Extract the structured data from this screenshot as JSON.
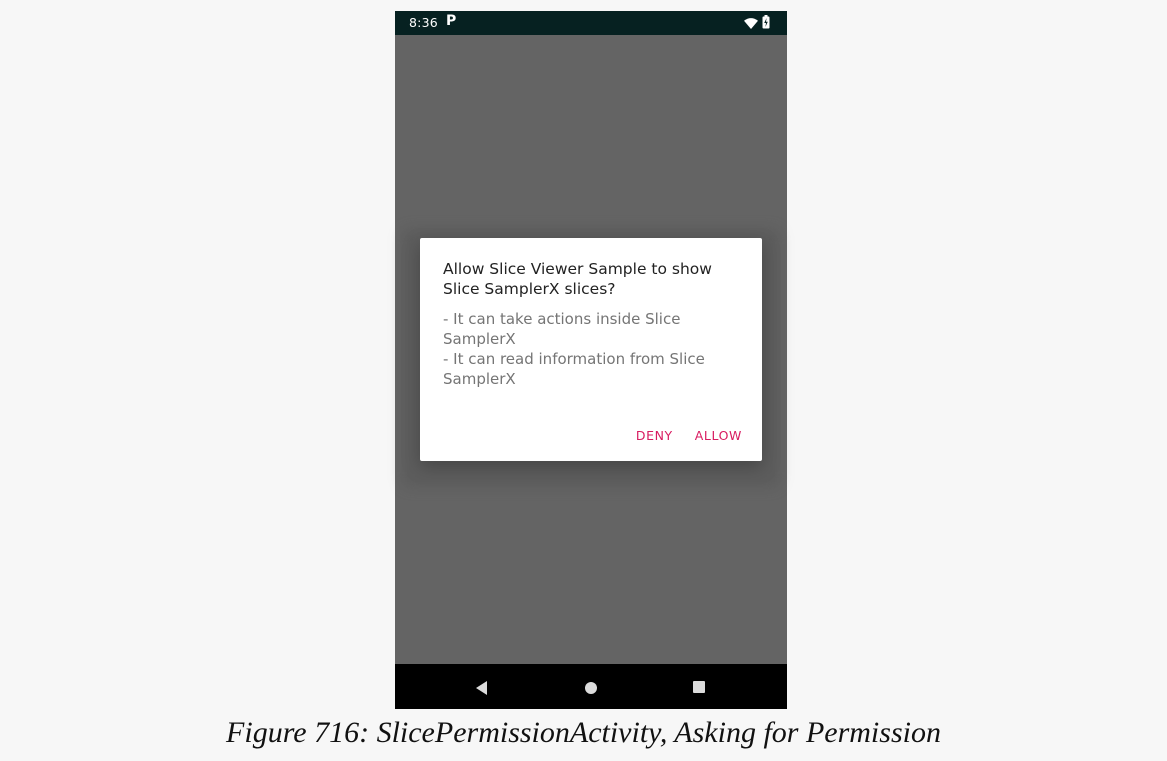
{
  "status_bar": {
    "time": "8:36",
    "notification_icon": "P",
    "icons": [
      "wifi-icon",
      "battery-icon"
    ]
  },
  "dialog": {
    "title": "Allow Slice Viewer Sample to show\nSlice SamplerX slices?",
    "message": "- It can take actions inside Slice\nSamplerX\n- It can read information from Slice\nSamplerX",
    "buttons": {
      "deny": "DENY",
      "allow": "ALLOW"
    },
    "accent_color": "#d81b60"
  },
  "navigation_bar": {
    "icons": [
      "back-icon",
      "home-icon",
      "recents-icon"
    ]
  },
  "caption": "Figure 716: SlicePermissionActivity, Asking for Permission"
}
